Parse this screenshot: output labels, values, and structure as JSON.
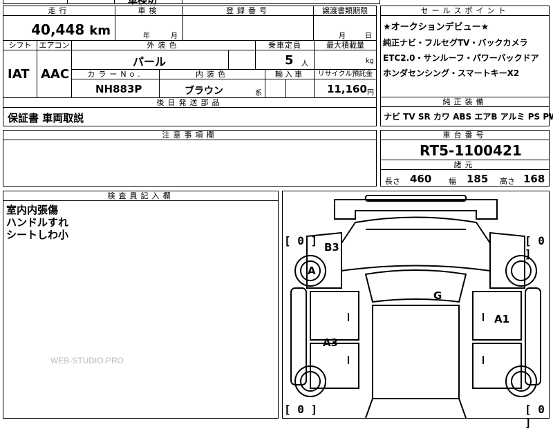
{
  "top_partial": "車検切",
  "mileage": {
    "label": "走行",
    "value": "40,448",
    "unit": "km"
  },
  "inspection": {
    "label": "車検",
    "year_unit": "年",
    "month_unit": "月"
  },
  "registration": {
    "label": "登録番号"
  },
  "transfer": {
    "label": "譲渡書類期限",
    "month_unit": "月",
    "day_unit": "日"
  },
  "shift": {
    "label": "シフト",
    "value": "IAT"
  },
  "aircon": {
    "label": "エアコン",
    "value": "AAC"
  },
  "exterior_color": {
    "label": "外装色",
    "value": "パール"
  },
  "capacity": {
    "label": "乗車定員",
    "value": "5",
    "unit": "人"
  },
  "max_load": {
    "label": "最大積載量",
    "unit": "kg"
  },
  "color_no": {
    "label": "カラーNo.",
    "value": "NH883P"
  },
  "interior_color": {
    "label": "内装色",
    "value": "ブラウン",
    "suffix": "系"
  },
  "import": {
    "label": "輸入車"
  },
  "recycle": {
    "label": "リサイクル預託金",
    "value": "11,160",
    "unit": "円"
  },
  "later_parts": {
    "label": "後日発送部品",
    "value": "保証書 車両取説"
  },
  "notes": {
    "label": "注意事項欄"
  },
  "sales_points": {
    "label": "セールスポイント",
    "lines": [
      "★オークションデビュー★",
      "純正ナビ・フルセグTV・バックカメラ",
      "ETC2.0・サンルーフ・パワーバックドア",
      "ホンダセンシング・スマートキーX2"
    ]
  },
  "equipment": {
    "label": "純正装備",
    "value": "ナビ TV SR カワ ABS エアB アルミ PS PW"
  },
  "chassis": {
    "label": "車台番号",
    "value": "RT5-1100421"
  },
  "dimensions": {
    "label": "諸元",
    "length_label": "長さ",
    "length": "460",
    "width_label": "幅",
    "width": "185",
    "height_label": "高さ",
    "height": "168"
  },
  "inspector": {
    "label": "検査員記入欄",
    "lines": [
      "室内内張傷",
      "ハンドルすれ",
      "シートしわ小"
    ]
  },
  "diagram": {
    "left_top": "[ 0 ]",
    "right_top": "[ 0 ]",
    "left_bottom": "[ 0 ]",
    "right_bottom": "[ 0 ]",
    "marks": {
      "b3": "B3",
      "a": "A",
      "g": "G",
      "a1": "A1",
      "a3": "A3"
    }
  },
  "watermark": "WEB-STUDIO.PRO"
}
